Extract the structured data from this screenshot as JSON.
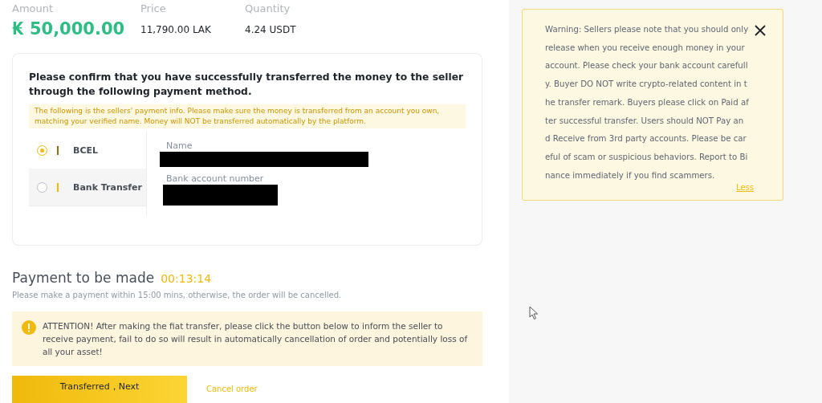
{
  "summary": [
    {
      "label": "Amount",
      "value": "₭ 50,000.00",
      "kind": "amount"
    },
    {
      "label": "Price",
      "value": "11,790.00 LAK",
      "kind": "plain"
    },
    {
      "label": "Quantity",
      "value": "4.24 USDT",
      "kind": "plain"
    }
  ],
  "confirm_card": {
    "title": "Please confirm that you have successfully transferred the money to the seller through the following payment method.",
    "notice": "The following is the sellers' payment info. Please make sure the money is transferred from an account you own, matching your verified name. Money will NOT be transferred automatically by the platform.",
    "methods": [
      {
        "label": "BCEL",
        "selected": true
      },
      {
        "label": "Bank Transfer",
        "selected": false
      }
    ],
    "fields": [
      {
        "label": "Name",
        "redacted": true
      },
      {
        "label": "Bank account number",
        "redacted": true
      }
    ]
  },
  "payment": {
    "title": "Payment to be made",
    "timer": "00:13:14",
    "hint": "Please make a payment within 15:00 mins, otherwise, the order will be cancelled.",
    "attention": "ATTENTION! After making the fiat transfer, please click the button below to inform the seller to receive payment, fail to do so will result in automatically cancellation of order and potentially loss of all your asset!",
    "primary_button": "Transferred，Next",
    "cancel_link": "Cancel order"
  },
  "warning": {
    "lines": [
      "Warning: Sellers please note that you should only",
      "release when you receive enough money in your",
      "account. Please check your bank account carefull",
      "y. Buyer DO NOT write crypto-related content in t",
      "he transfer remark. Buyers please click on Paid af",
      "ter successful transfer. Users should NOT Pay an",
      "d Receive from 3rd party accounts. Please be car",
      "eful of scam or suspicious behaviors. Report to Bi",
      "nance immediately if you find scammers."
    ],
    "toggle": "Less"
  }
}
